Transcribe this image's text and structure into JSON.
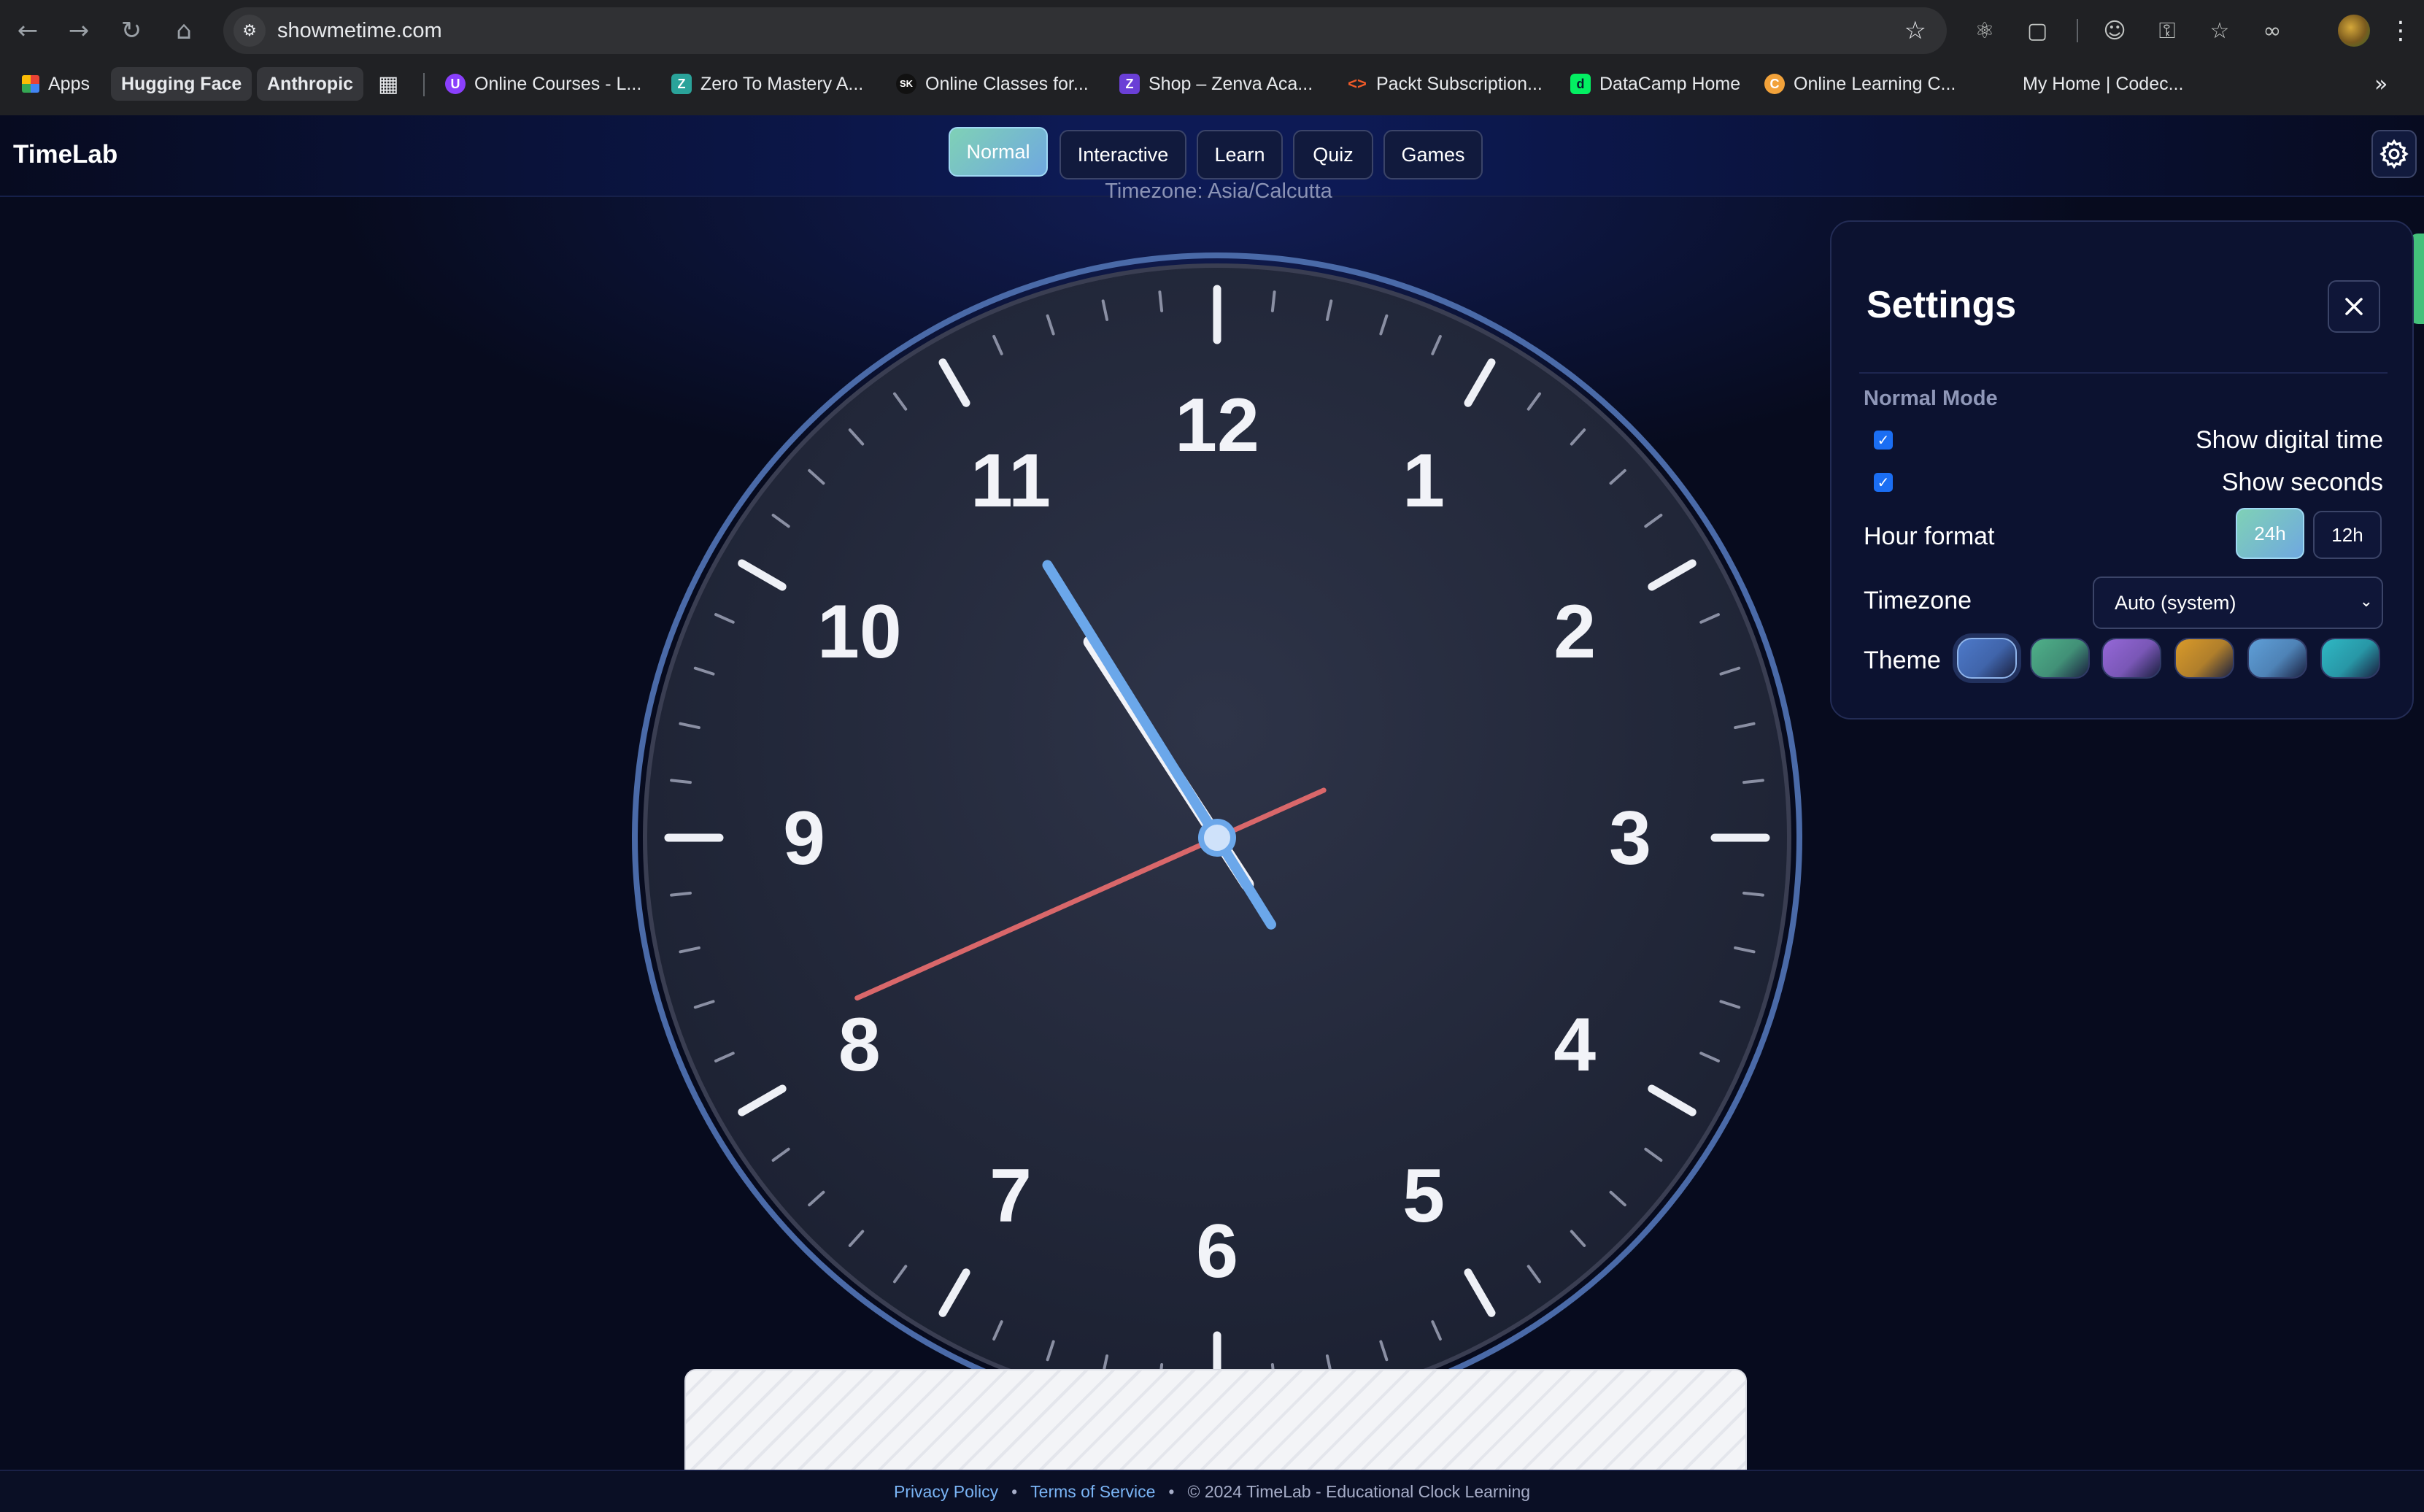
{
  "browser": {
    "url": "showmetime.com",
    "bookmarks": [
      {
        "label": "Apps"
      },
      {
        "label": "Hugging Face"
      },
      {
        "label": "Anthropic"
      },
      {
        "label": "Online Courses - L..."
      },
      {
        "label": "Zero To Mastery A..."
      },
      {
        "label": "Online Classes for..."
      },
      {
        "label": "Shop – Zenva Aca..."
      },
      {
        "label": "Packt Subscription..."
      },
      {
        "label": "DataCamp Home"
      },
      {
        "label": "Online Learning C..."
      },
      {
        "label": "My Home | Codec..."
      }
    ]
  },
  "app": {
    "logo": "TimeLab",
    "tabs": [
      {
        "label": "Normal",
        "active": true
      },
      {
        "label": "Interactive"
      },
      {
        "label": "Learn"
      },
      {
        "label": "Quiz"
      },
      {
        "label": "Games"
      }
    ],
    "timezone_text": "Timezone: Asia/Calcutta"
  },
  "clock": {
    "numerals": [
      "12",
      "1",
      "2",
      "3",
      "4",
      "5",
      "6",
      "7",
      "8",
      "9",
      "10",
      "11"
    ],
    "time": {
      "hour": 10,
      "minute": 54,
      "second": 41
    },
    "colors": {
      "hour_hand": "#ffffff",
      "minute_hand": "#6ba7ea",
      "second_hand": "#d9676a",
      "ring": "#3f5f9c"
    }
  },
  "settings": {
    "title": "Settings",
    "section": "Normal Mode",
    "show_digital": {
      "label": "Show digital time",
      "checked": true
    },
    "show_seconds": {
      "label": "Show seconds",
      "checked": true
    },
    "hour_format": {
      "label": "Hour format",
      "options": [
        "24h",
        "12h"
      ],
      "selected": "24h"
    },
    "timezone": {
      "label": "Timezone",
      "value": "Auto (system)"
    },
    "theme": {
      "label": "Theme",
      "swatches": [
        "#4d79c9",
        "#4fb089",
        "#9568d8",
        "#d99a2a",
        "#5f9fd8",
        "#2fb8c4"
      ],
      "selected": 0
    }
  },
  "footer": {
    "privacy": "Privacy Policy",
    "terms": "Terms of Service",
    "copyright": "© 2024 TimeLab - Educational Clock Learning"
  }
}
